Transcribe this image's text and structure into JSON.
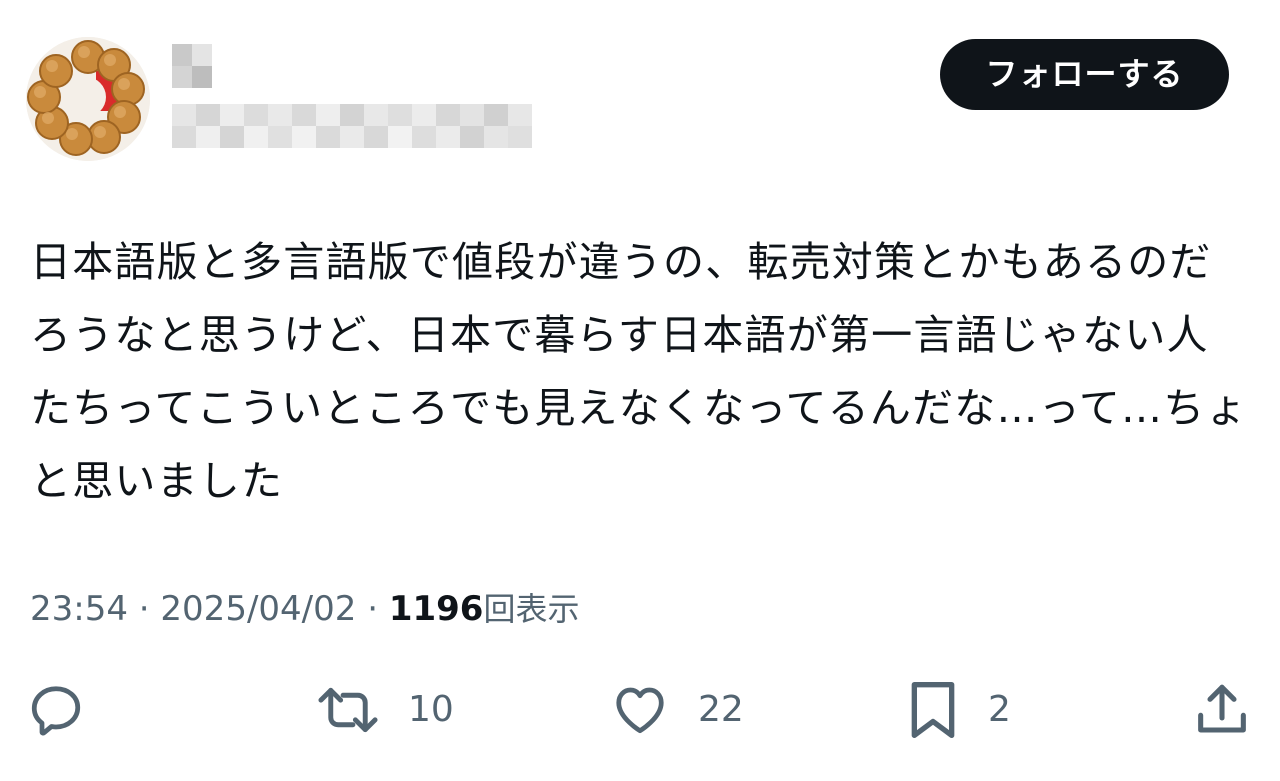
{
  "header": {
    "follow_label": "フォローする"
  },
  "tweet": {
    "text": "日本語版と多言語版で値段が違うの、転売対策とかもあるのだろうなと思うけど、日本で暮らす日本語が第一言語じゃない人たちってこういところでも見えなくなってるんだな…って…ちょと思いました",
    "time": "23:54",
    "separator": "·",
    "date": "2025/04/02",
    "views_count": "1196",
    "views_label": "回表示"
  },
  "actions": {
    "reply_icon": "reply-icon",
    "retweet_icon": "retweet-icon",
    "retweet_count": "10",
    "like_icon": "heart-icon",
    "like_count": "22",
    "bookmark_icon": "bookmark-icon",
    "bookmark_count": "2",
    "share_icon": "share-icon"
  },
  "colors": {
    "text_primary": "#0f1419",
    "text_secondary": "#536471",
    "button_bg": "#0f1419",
    "button_text": "#ffffff",
    "background": "#ffffff"
  }
}
